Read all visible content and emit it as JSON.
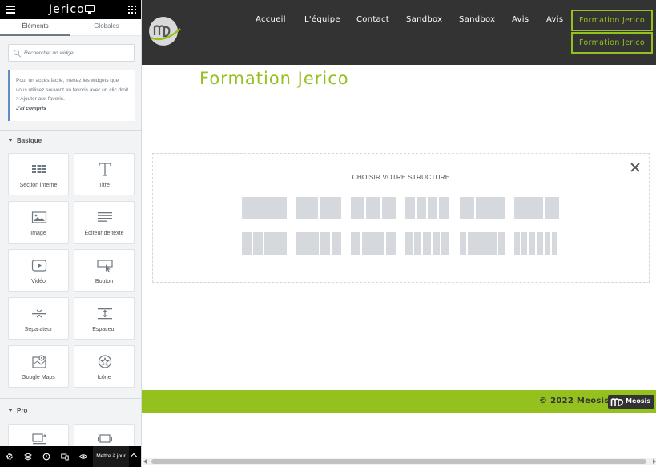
{
  "panel": {
    "logo": "Jerico",
    "tabs": [
      {
        "label": "Éléments",
        "active": true
      },
      {
        "label": "Globales",
        "active": false
      }
    ],
    "search": {
      "placeholder": "Rechercher un widget..."
    },
    "hint": {
      "text": "Pour un accès facile, mettez les widgets que vous utilisez souvent en favoris avec un clic droit > Ajouter aux favoris.",
      "link": "J'ai compris"
    },
    "sections": [
      {
        "title": "Basique",
        "widgets": [
          {
            "label": "Section interne",
            "icon": "inner-section-icon"
          },
          {
            "label": "Titre",
            "icon": "heading-icon"
          },
          {
            "label": "Image",
            "icon": "image-icon"
          },
          {
            "label": "Éditeur de texte",
            "icon": "text-editor-icon"
          },
          {
            "label": "Vidéo",
            "icon": "video-icon"
          },
          {
            "label": "Bouton",
            "icon": "button-icon"
          },
          {
            "label": "Séparateur",
            "icon": "divider-icon"
          },
          {
            "label": "Espaceur",
            "icon": "spacer-icon"
          },
          {
            "label": "Google Maps",
            "icon": "map-icon"
          },
          {
            "label": "Icône",
            "icon": "star-icon"
          }
        ]
      },
      {
        "title": "Pro"
      }
    ],
    "footer": {
      "update_label": "Mettre à jour"
    }
  },
  "site": {
    "nav": [
      "Accueil",
      "L'équipe",
      "Contact",
      "Sandbox",
      "Sandbox",
      "Avis",
      "Avis"
    ],
    "nav_buttons": [
      "Formation Jerico",
      "Formation Jerico"
    ],
    "heading": "Formation Jerico",
    "structure": {
      "title": "CHOISIR VOTRE STRUCTURE"
    },
    "footer": {
      "copyright": "© 2022 Meosis",
      "logo_text": "Meosis"
    }
  },
  "colors": {
    "accent": "#95c11f",
    "header_bg": "#333333",
    "panel_bg": "#f1f3f5",
    "panel_header_bg": "#000000"
  }
}
